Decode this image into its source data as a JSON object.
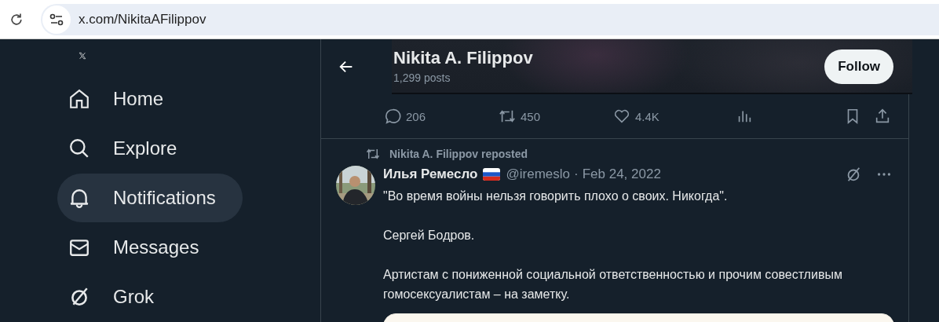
{
  "browser": {
    "url": "x.com/NikitaAFilippov"
  },
  "sidebar": {
    "items": [
      {
        "kind": "home",
        "label": "Home",
        "selected": false
      },
      {
        "kind": "explore",
        "label": "Explore",
        "selected": false
      },
      {
        "kind": "notifications",
        "label": "Notifications",
        "selected": true
      },
      {
        "kind": "messages",
        "label": "Messages",
        "selected": false
      },
      {
        "kind": "grok",
        "label": "Grok",
        "selected": false
      }
    ]
  },
  "header": {
    "name": "Nikita A. Filippov",
    "posts": "1,299 posts",
    "follow_button": "Follow"
  },
  "previous_post_actions": {
    "replies": "206",
    "reposts": "450",
    "likes": "4.4K"
  },
  "post": {
    "repost_label": "Nikita A. Filippov reposted",
    "author": "Илья Ремесло",
    "handle": "@iremeslo",
    "separator": "·",
    "date": "Feb 24, 2022",
    "paragraphs": [
      "\"Во время войны нельзя говорить плохо о своих. Никогда\".",
      "Сергей Бодров.",
      "Артистам с пониженной социальной ответственностью и прочим совестливым гомосексуалистам – на заметку."
    ]
  }
}
